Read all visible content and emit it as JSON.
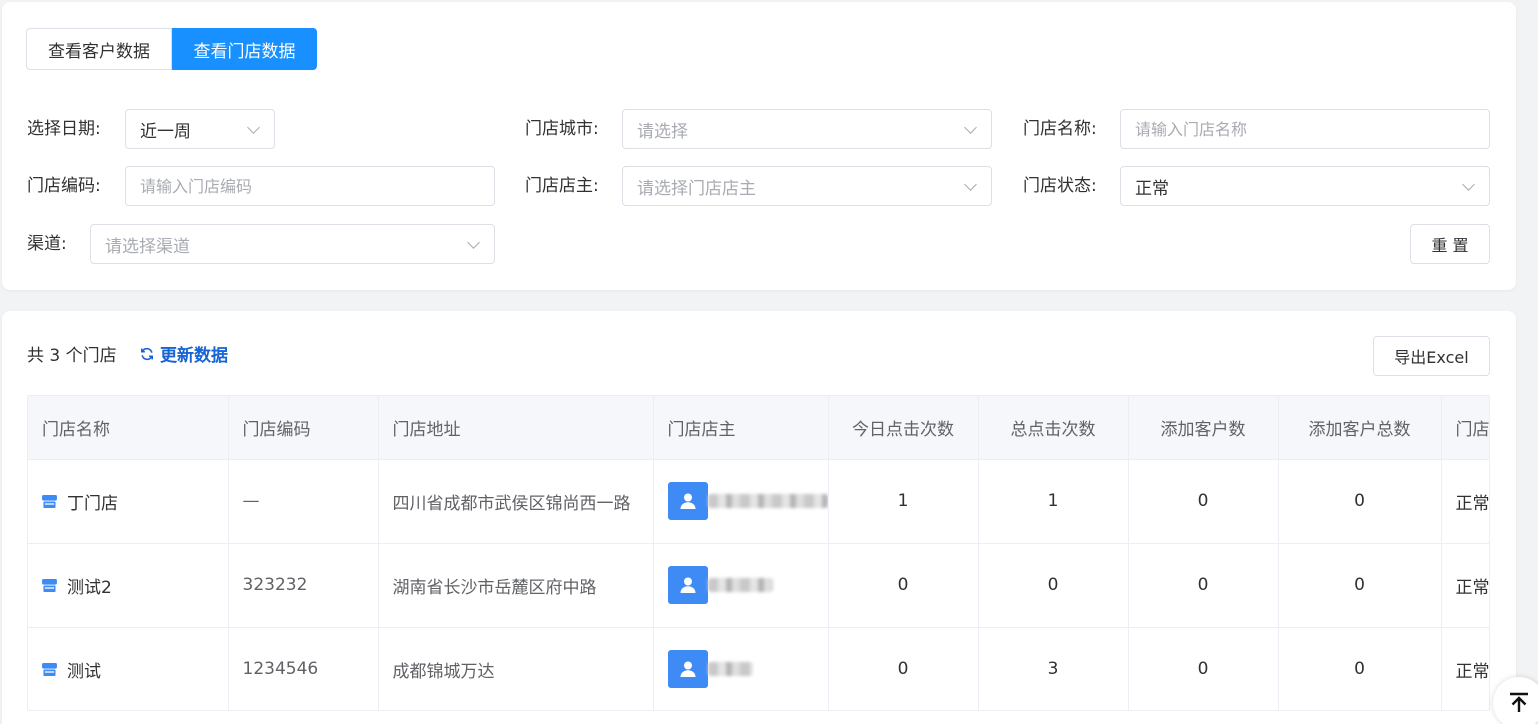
{
  "tabs": [
    {
      "label": "查看客户数据",
      "active": false
    },
    {
      "label": "查看门店数据",
      "active": true
    }
  ],
  "filters": {
    "date": {
      "label": "选择日期:",
      "value": "近一周"
    },
    "city": {
      "label": "门店城市:",
      "placeholder": "请选择"
    },
    "name": {
      "label": "门店名称:",
      "placeholder": "请输入门店名称"
    },
    "code": {
      "label": "门店编码:",
      "placeholder": "请输入门店编码"
    },
    "owner": {
      "label": "门店店主:",
      "placeholder": "请选择门店店主"
    },
    "status": {
      "label": "门店状态:",
      "value": "正常"
    },
    "channel": {
      "label": "渠道:",
      "placeholder": "请选择渠道"
    },
    "reset_label": "重 置"
  },
  "summary": {
    "count_text": "共 3 个门店",
    "refresh_label": "更新数据",
    "export_label": "导出Excel"
  },
  "table": {
    "columns": [
      "门店名称",
      "门店编码",
      "门店地址",
      "门店店主",
      "今日点击次数",
      "总点击次数",
      "添加客户数",
      "添加客户总数",
      "门店状态"
    ],
    "rows": [
      {
        "name": "丁门店",
        "code": "—",
        "address": "四川省成都市武侯区锦尚西一路",
        "today_clicks": "1",
        "total_clicks": "1",
        "added": "0",
        "added_total": "0",
        "status": "正常"
      },
      {
        "name": "测试2",
        "code": "323232",
        "address": "湖南省长沙市岳麓区府中路",
        "today_clicks": "0",
        "total_clicks": "0",
        "added": "0",
        "added_total": "0",
        "status": "正常"
      },
      {
        "name": "测试",
        "code": "1234546",
        "address": "成都锦城万达",
        "today_clicks": "0",
        "total_clicks": "3",
        "added": "0",
        "added_total": "0",
        "status": "正常"
      }
    ]
  },
  "icons": {
    "store": "store-icon",
    "avatar": "user-icon",
    "refresh": "refresh-icon",
    "backtop": "arrow-up-to-top-icon"
  },
  "colors": {
    "primary": "#1890ff",
    "link": "#1764d4",
    "avatar_bg": "#3f8bf6"
  }
}
